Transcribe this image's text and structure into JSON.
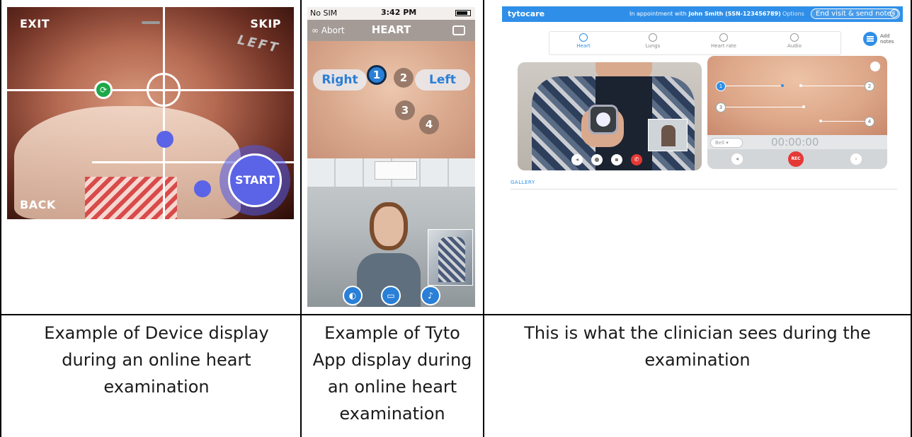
{
  "device_display": {
    "exit_label": "EXIT",
    "skip_label": "SKIP",
    "left_label": "LEFT",
    "back_label": "BACK",
    "start_label": "START",
    "caption": "Example of Device display during an online heart examination"
  },
  "tyto_app": {
    "status": {
      "carrier": "No SIM",
      "time": "3:42 PM"
    },
    "nav": {
      "abort_label": "Abort",
      "title": "HEART"
    },
    "side_buttons": {
      "right": "Right",
      "left": "Left"
    },
    "points": [
      "1",
      "2",
      "3",
      "4"
    ],
    "active_point": "1",
    "caption": "Example of Tyto App display during an online heart examination"
  },
  "clinician_view": {
    "logo": "tytocare",
    "appointment_prefix": "In appointment with ",
    "patient": "John Smith (SSN-123456789)",
    "options_label": "Options",
    "end_visit_label": "End visit & send notes",
    "info_icon": "i",
    "tabs": [
      "Heart",
      "Lungs",
      "Heart rate",
      "Audio"
    ],
    "active_tab": "Heart",
    "add_notes_label": "Add notes",
    "body_points": [
      "1",
      "2",
      "3",
      "4"
    ],
    "filter_value": "Bell",
    "timer": "00:00:00",
    "rec_label": "REC",
    "gallery_label": "GALLERY",
    "caption": "This is what the clinician sees during the examination"
  },
  "colors": {
    "accent_blue": "#2f8fe8",
    "device_purple": "#5b63e6",
    "green_marker": "#1ea84a",
    "rec_red": "#e53935"
  }
}
